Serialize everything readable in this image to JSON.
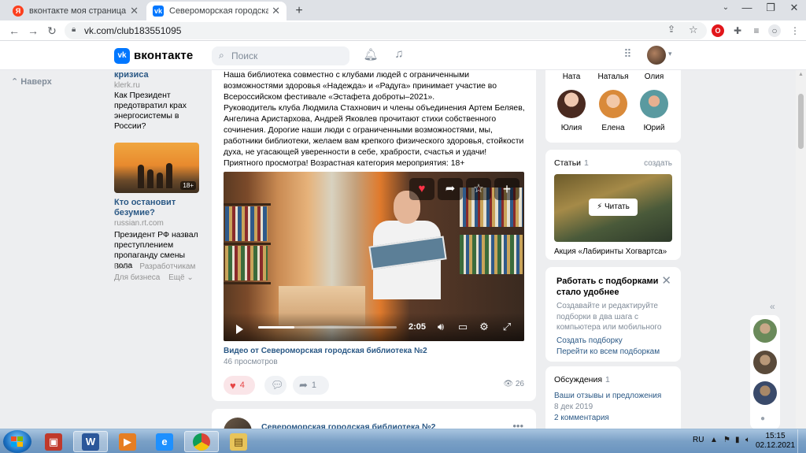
{
  "browser": {
    "tabs": [
      {
        "title": "вконтакте моя страница — Янд",
        "icon": "yandex-icon"
      },
      {
        "title": "Североморская городская библи",
        "icon": "vk-icon"
      }
    ],
    "url": "vk.com/club183551095"
  },
  "vk": {
    "brand": "вконтакте",
    "search_placeholder": "Поиск"
  },
  "left": {
    "back": "Наверх",
    "ad1": {
      "title_tail": "кризиса",
      "domain": "klerk.ru",
      "desc": "Как Президент предотвратил крах энергосистемы в России?"
    },
    "ad2": {
      "badge": "18+",
      "title": "Кто остановит безумие?",
      "domain": "russian.rt.com",
      "desc": "Президент РФ назвал преступлением пропаганду смены пола"
    },
    "footer": [
      "Блог",
      "Разработчикам",
      "Для бизнеса",
      "Ещё ⌄"
    ]
  },
  "post": {
    "paragraphs": [
      "Наша библиотека совместно с клубами людей с ограниченными возможностями здоровья «Надежда» и «Радуга» принимает участие во Всероссийском фестивале «Эстафета доброты–2021».",
      "Руководитель клуба Людмила Стахнович и члены объединения Артем Беляев, Ангелина Аристархова, Андрей Яковлев прочитают стихи собственного сочинения. Дорогие наши люди с ограниченными возможностями, мы, работники библиотеки, желаем вам крепкого физического здоровья, стойкости духа, не угасающей уверенности в себе, храбрости, счастья и удачи!",
      "Приятного просмотра! Возрастная категория мероприятия: 18+"
    ],
    "video": {
      "duration": "2:05",
      "progress": 0.26,
      "title": "Видео от Североморская городская библиотека №2",
      "views": "46 просмотров"
    },
    "likes": "4",
    "shares": "1",
    "view_count": "26"
  },
  "post2": {
    "author": "Североморская городская библиотека №2"
  },
  "members": [
    "Ната",
    "Наталья",
    "Олия",
    "Юлия",
    "Елена",
    "Юрий"
  ],
  "articles": {
    "header": "Статьи",
    "count": "1",
    "create": "создать",
    "read": "Читать",
    "title": "Акция «Лабиринты Хогвартса»"
  },
  "promo": {
    "title": "Работать с подборками стало удобнее",
    "desc": "Создавайте и редактируйте подборки в два шага с компьютера или мобильного",
    "link1": "Создать подборку",
    "link2": "Перейти ко всем подборкам"
  },
  "discussions": {
    "header": "Обсуждения",
    "count": "1",
    "topic": "Ваши отзывы и предложения",
    "date": "8 дек 2019",
    "comments": "2 комментария"
  },
  "taskbar": {
    "lang": "RU",
    "time": "15:15",
    "date": "02.12.2021"
  }
}
